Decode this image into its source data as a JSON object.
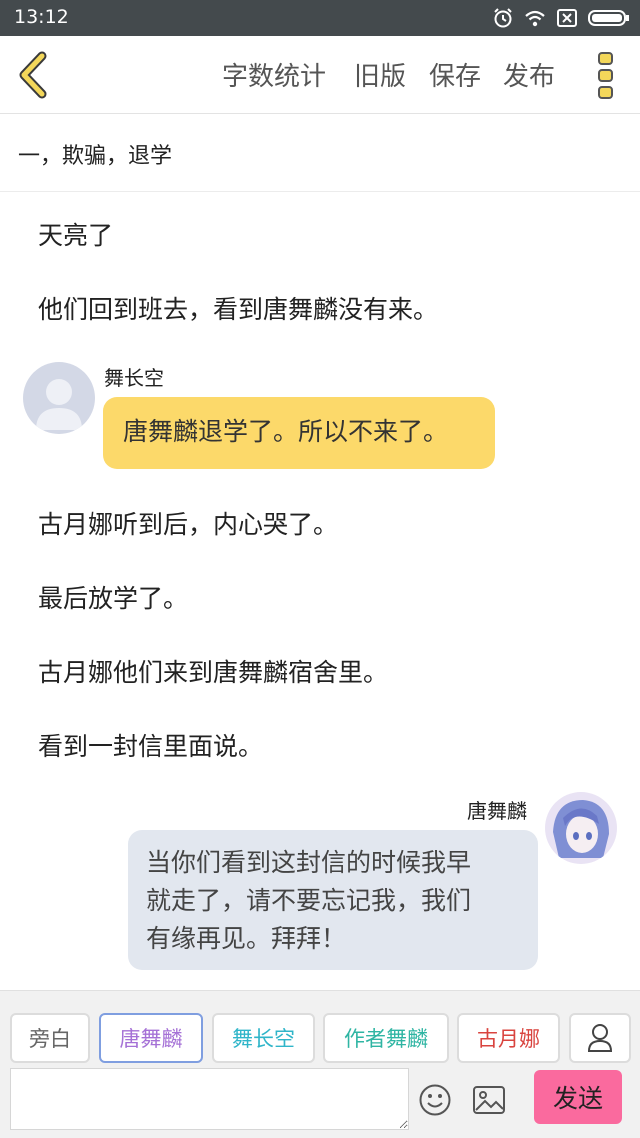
{
  "status_bar": {
    "time": "13:12",
    "icons": [
      "alarm-icon",
      "wifi-icon",
      "sim-icon",
      "battery-icon"
    ]
  },
  "toolbar": {
    "word_count_label": "字数统计",
    "old_version_label": "旧版",
    "save_label": "保存",
    "publish_label": "发布",
    "accent_color": "#e8c94a"
  },
  "chapter": {
    "title": "一，欺骗，退学"
  },
  "content": [
    {
      "kind": "narration",
      "text": "天亮了"
    },
    {
      "kind": "narration",
      "text": "他们回到班去，看到唐舞麟没有来。"
    },
    {
      "kind": "dialogue",
      "speaker": "舞长空",
      "side": "left",
      "text": "唐舞麟退学了。所以不来了。"
    },
    {
      "kind": "narration",
      "text": "古月娜听到后，内心哭了。"
    },
    {
      "kind": "narration",
      "text": "最后放学了。"
    },
    {
      "kind": "narration",
      "text": "古月娜他们来到唐舞麟宿舍里。"
    },
    {
      "kind": "narration",
      "text": "看到一封信里面说。"
    },
    {
      "kind": "dialogue",
      "speaker": "唐舞麟",
      "side": "right",
      "lines": [
        "当你们看到这封信的时候我早",
        "就走了，请不要忘记我，我们",
        "有缘再见。拜拜！"
      ]
    }
  ],
  "role_chips": [
    {
      "label": "旁白",
      "color": "#666666",
      "selected": false
    },
    {
      "label": "唐舞麟",
      "color": "#a571d6",
      "selected": true
    },
    {
      "label": "舞长空",
      "color": "#2fb5c9",
      "selected": false
    },
    {
      "label": "作者舞麟",
      "color": "#2fb5a3",
      "selected": false
    },
    {
      "label": "古月娜",
      "color": "#d9443f",
      "selected": false
    }
  ],
  "composer": {
    "input_value": "",
    "send_label": "发送",
    "send_color": "#fa6a9e"
  }
}
